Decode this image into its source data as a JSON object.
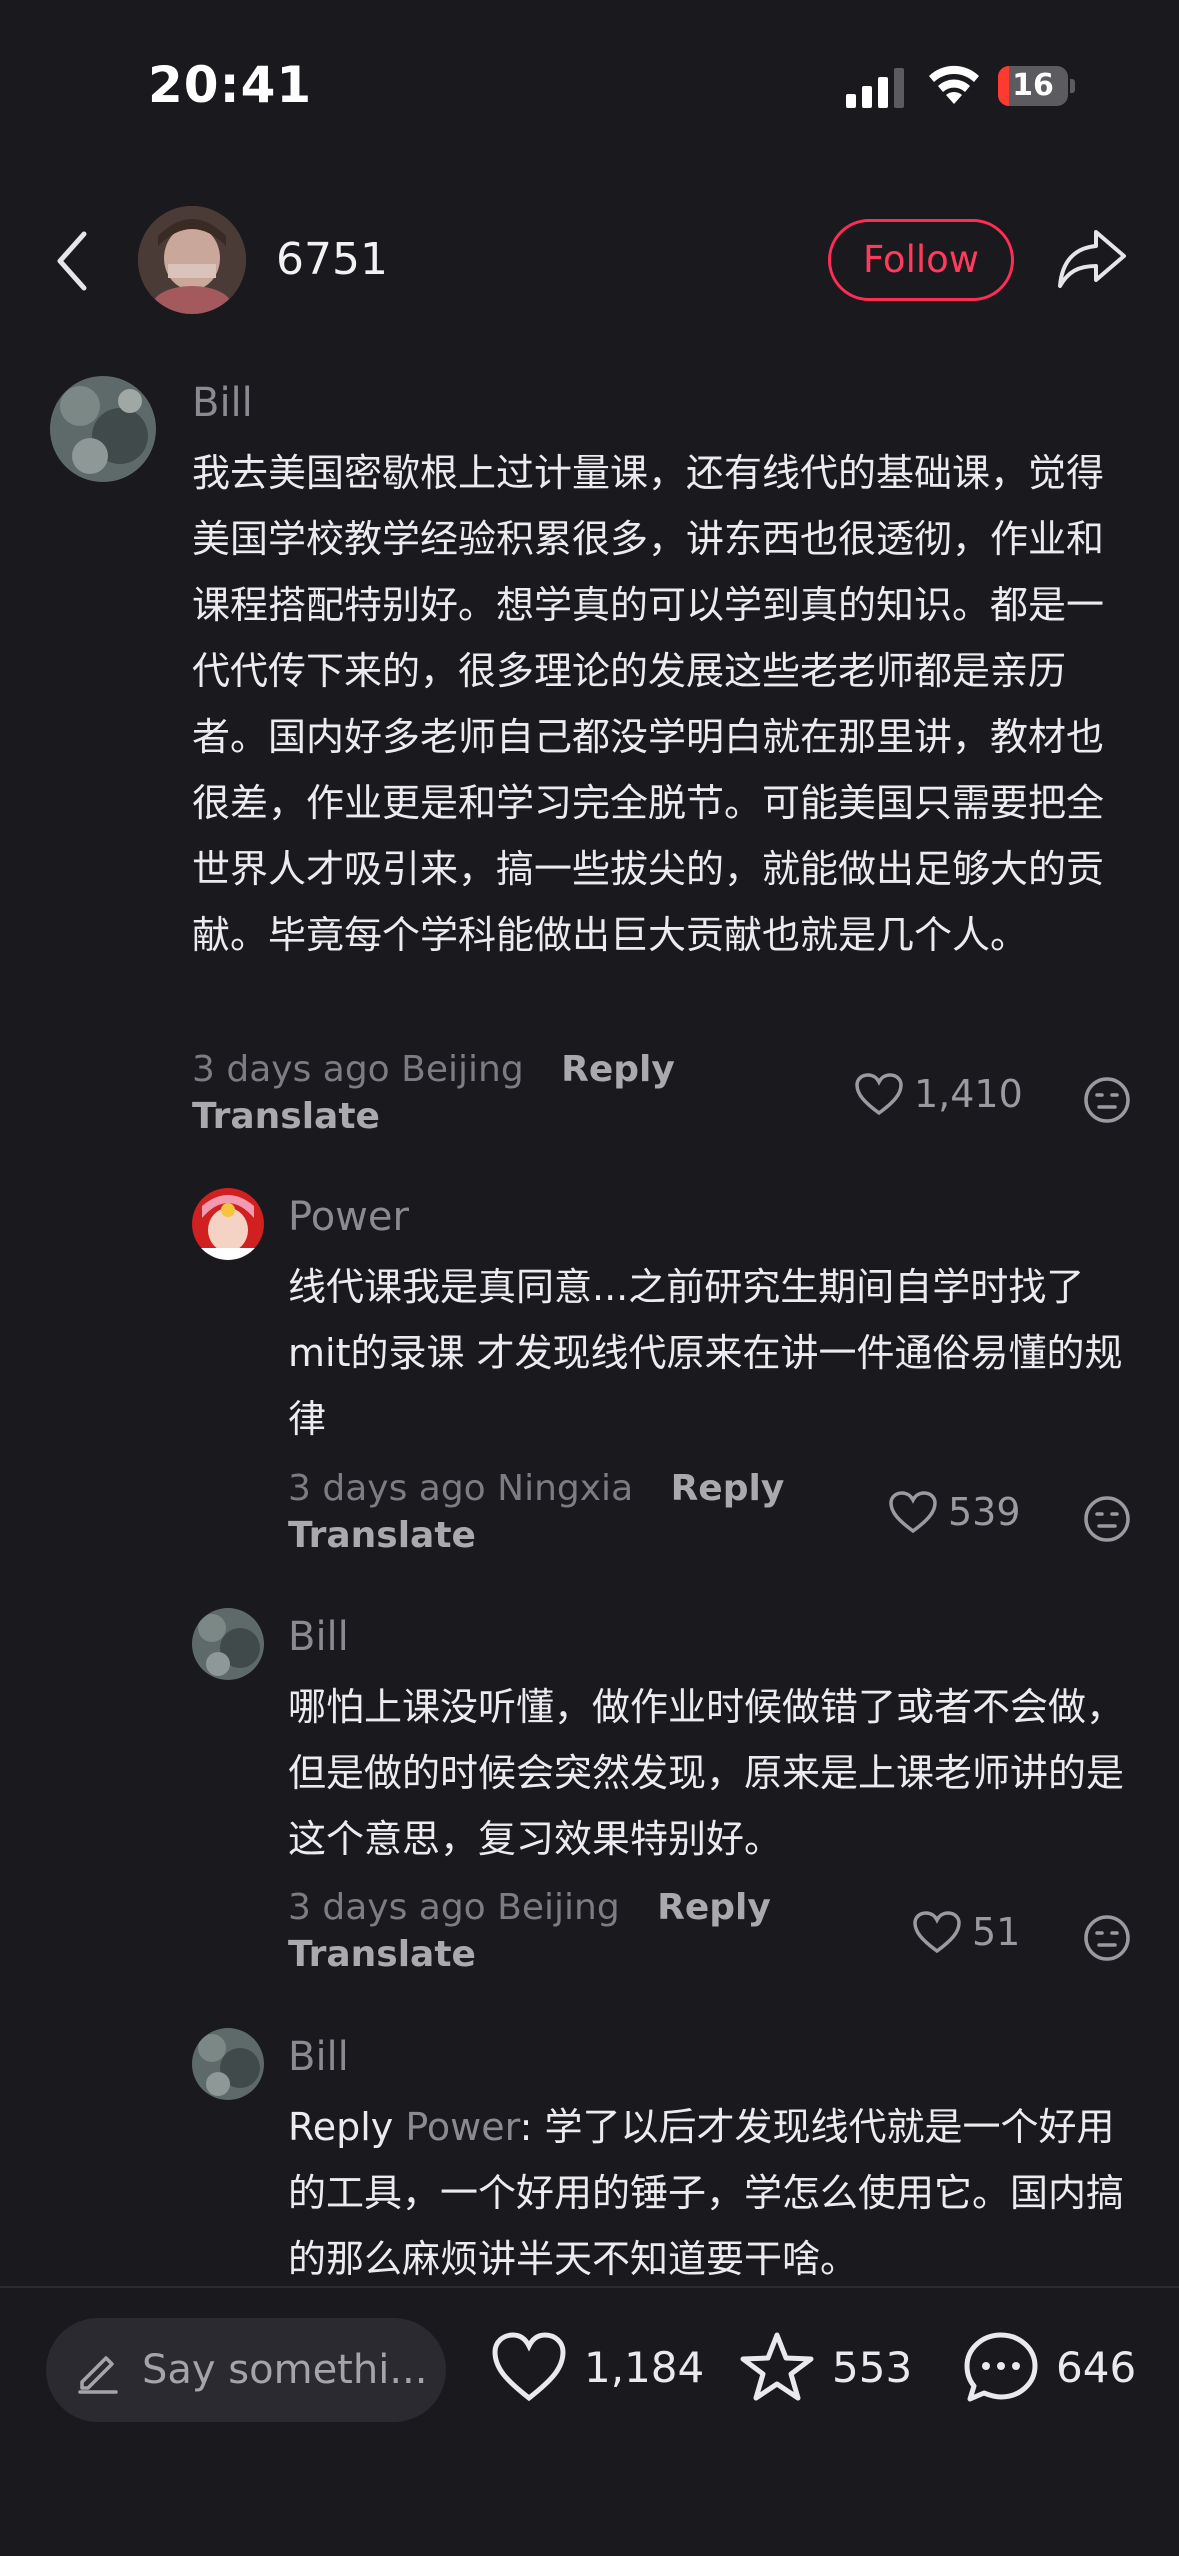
{
  "status": {
    "time": "20:41",
    "battery": "16",
    "battery_percent": 16
  },
  "header": {
    "username": "6751",
    "follow_label": "Follow"
  },
  "comments": [
    {
      "name": "Bill",
      "text": "我去美国密歇根上过计量课，还有线代的基础课，觉得美国学校教学经验积累很多，讲东西也很透彻，作业和课程搭配特别好。想学真的可以学到真的知识。都是一代代传下来的，很多理论的发展这些老老师都是亲历者。国内好多老师自己都没学明白就在那里讲，教材也很差，作业更是和学习完全脱节。可能美国只需要把全世界人才吸引来，搞一些拔尖的，就能做出足够大的贡献。毕竟每个学科能做出巨大贡献也就是几个人。",
      "time": "3 days ago",
      "location": "Beijing",
      "reply_label": "Reply",
      "translate_label": "Translate",
      "likes": "1,410"
    },
    {
      "name": "Power",
      "text": "线代课我是真同意...之前研究生期间自学时找了mit的录课 才发现线代原来在讲一件通俗易懂的规律",
      "time": "3 days ago",
      "location": "Ningxia",
      "reply_label": "Reply",
      "translate_label": "Translate",
      "likes": "539"
    },
    {
      "name": "Bill",
      "text": "哪怕上课没听懂，做作业时候做错了或者不会做，但是做的时候会突然发现，原来是上课老师讲的是这个意思，复习效果特别好。",
      "time": "3 days ago",
      "location": "Beijing",
      "reply_label": "Reply",
      "translate_label": "Translate",
      "likes": "51"
    },
    {
      "name": "Bill",
      "reply_prefix": "Reply",
      "reply_to": "Power",
      "text": ": 学了以后才发现线代就是一个好用的工具，一个好用的锤子，学怎么使用它。国内搞的那么麻烦讲半天不知道要干啥。"
    }
  ],
  "bottom": {
    "input_placeholder": "Say somethi...",
    "likes": "1,184",
    "stars": "553",
    "comments": "646"
  },
  "colors": {
    "accent": "#ff2d55",
    "background": "#19191e"
  }
}
